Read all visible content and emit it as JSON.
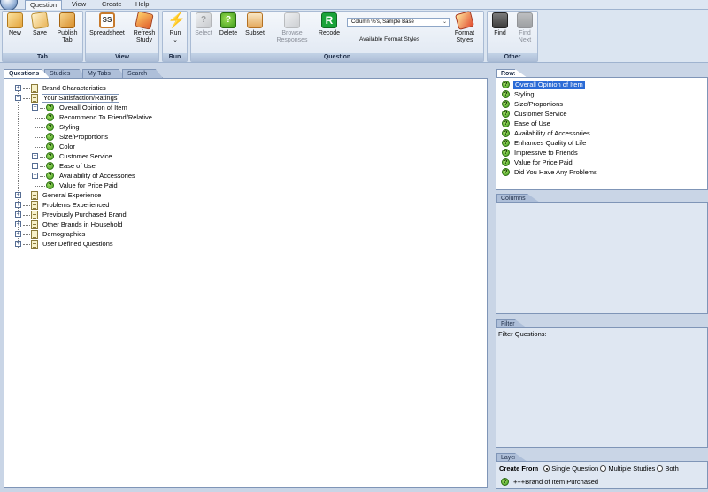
{
  "menubar": {
    "tabs": [
      "Question",
      "View",
      "Create",
      "Help"
    ],
    "active": "Question"
  },
  "ribbon": {
    "groups": {
      "tab": {
        "label": "Tab",
        "buttons": [
          "New",
          "Save",
          "Publish Tab"
        ]
      },
      "view": {
        "label": "View",
        "buttons": [
          "Spreadsheet",
          "Refresh Study"
        ]
      },
      "run": {
        "label": "Run",
        "buttons": [
          "Run"
        ]
      },
      "question": {
        "label": "Question",
        "buttons": [
          "Select",
          "Delete",
          "Subset",
          "Browse Responses",
          "Recode",
          "Format Styles"
        ],
        "combo_value": "Column %'s, Sample Base",
        "combo_label": "Available Format Styles"
      },
      "other": {
        "label": "Other",
        "buttons": [
          "Find",
          "Find Next"
        ]
      }
    },
    "ss_glyph": "SS",
    "recode_glyph": "R",
    "run_glyph": "⚡",
    "run_chevron": "⌄"
  },
  "left_tabs": [
    "Questions",
    "Studies",
    "My Tabs",
    "Search"
  ],
  "tree": {
    "expander_glyph": "+",
    "collapser_glyph": "−",
    "q_glyph": "?",
    "nodes": [
      "Brand Characteristics",
      "Your Satisfaction/Ratings",
      "Overall Opinion of Item",
      "Recommend To Friend/Relative",
      "Styling",
      "Size/Proportions",
      "Color",
      "Customer Service",
      "Ease of Use",
      "Availability of Accessories",
      "Value for Price Paid",
      "General Experience",
      "Problems Experienced",
      "Previously Purchased Brand",
      "Other Brands in Household",
      "Demographics",
      "User Defined Questions"
    ]
  },
  "rows_panel": {
    "title": "Rows",
    "items": [
      "Overall Opinion of Item",
      "Styling",
      "Size/Proportions",
      "Customer Service",
      "Ease of Use",
      "Availability of Accessories",
      "Enhances Quality of Life",
      "Impressive to Friends",
      "Value for Price Paid",
      "Did You Have Any Problems"
    ]
  },
  "columns_panel": {
    "title": "Columns"
  },
  "filter_panel": {
    "title": "Filter",
    "text": "Filter Questions:"
  },
  "layer_panel": {
    "title": "Layer",
    "create_from_label": "Create From",
    "options": [
      "Single Question",
      "Multiple Studies",
      "Both"
    ],
    "selected": "Single Question",
    "item": "+++Brand of Item Purchased"
  },
  "colors": {
    "accent": "#2b6bd6",
    "ribbon": "#dbe5f1",
    "background": "#c9d5e6"
  }
}
